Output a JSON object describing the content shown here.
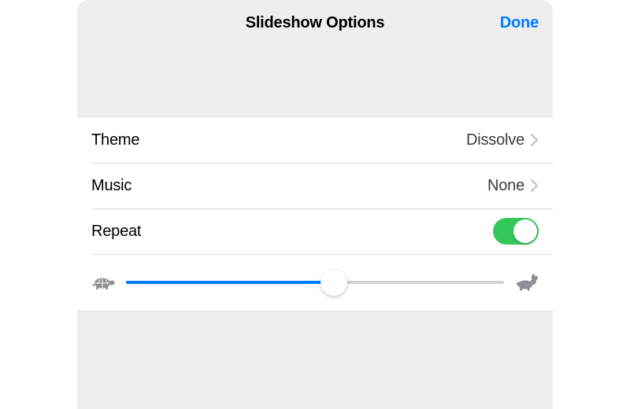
{
  "navbar": {
    "title": "Slideshow Options",
    "done": "Done"
  },
  "rows": {
    "theme": {
      "label": "Theme",
      "value": "Dissolve"
    },
    "music": {
      "label": "Music",
      "value": "None"
    },
    "repeat": {
      "label": "Repeat",
      "on": true
    }
  },
  "slider": {
    "percent": 55
  }
}
